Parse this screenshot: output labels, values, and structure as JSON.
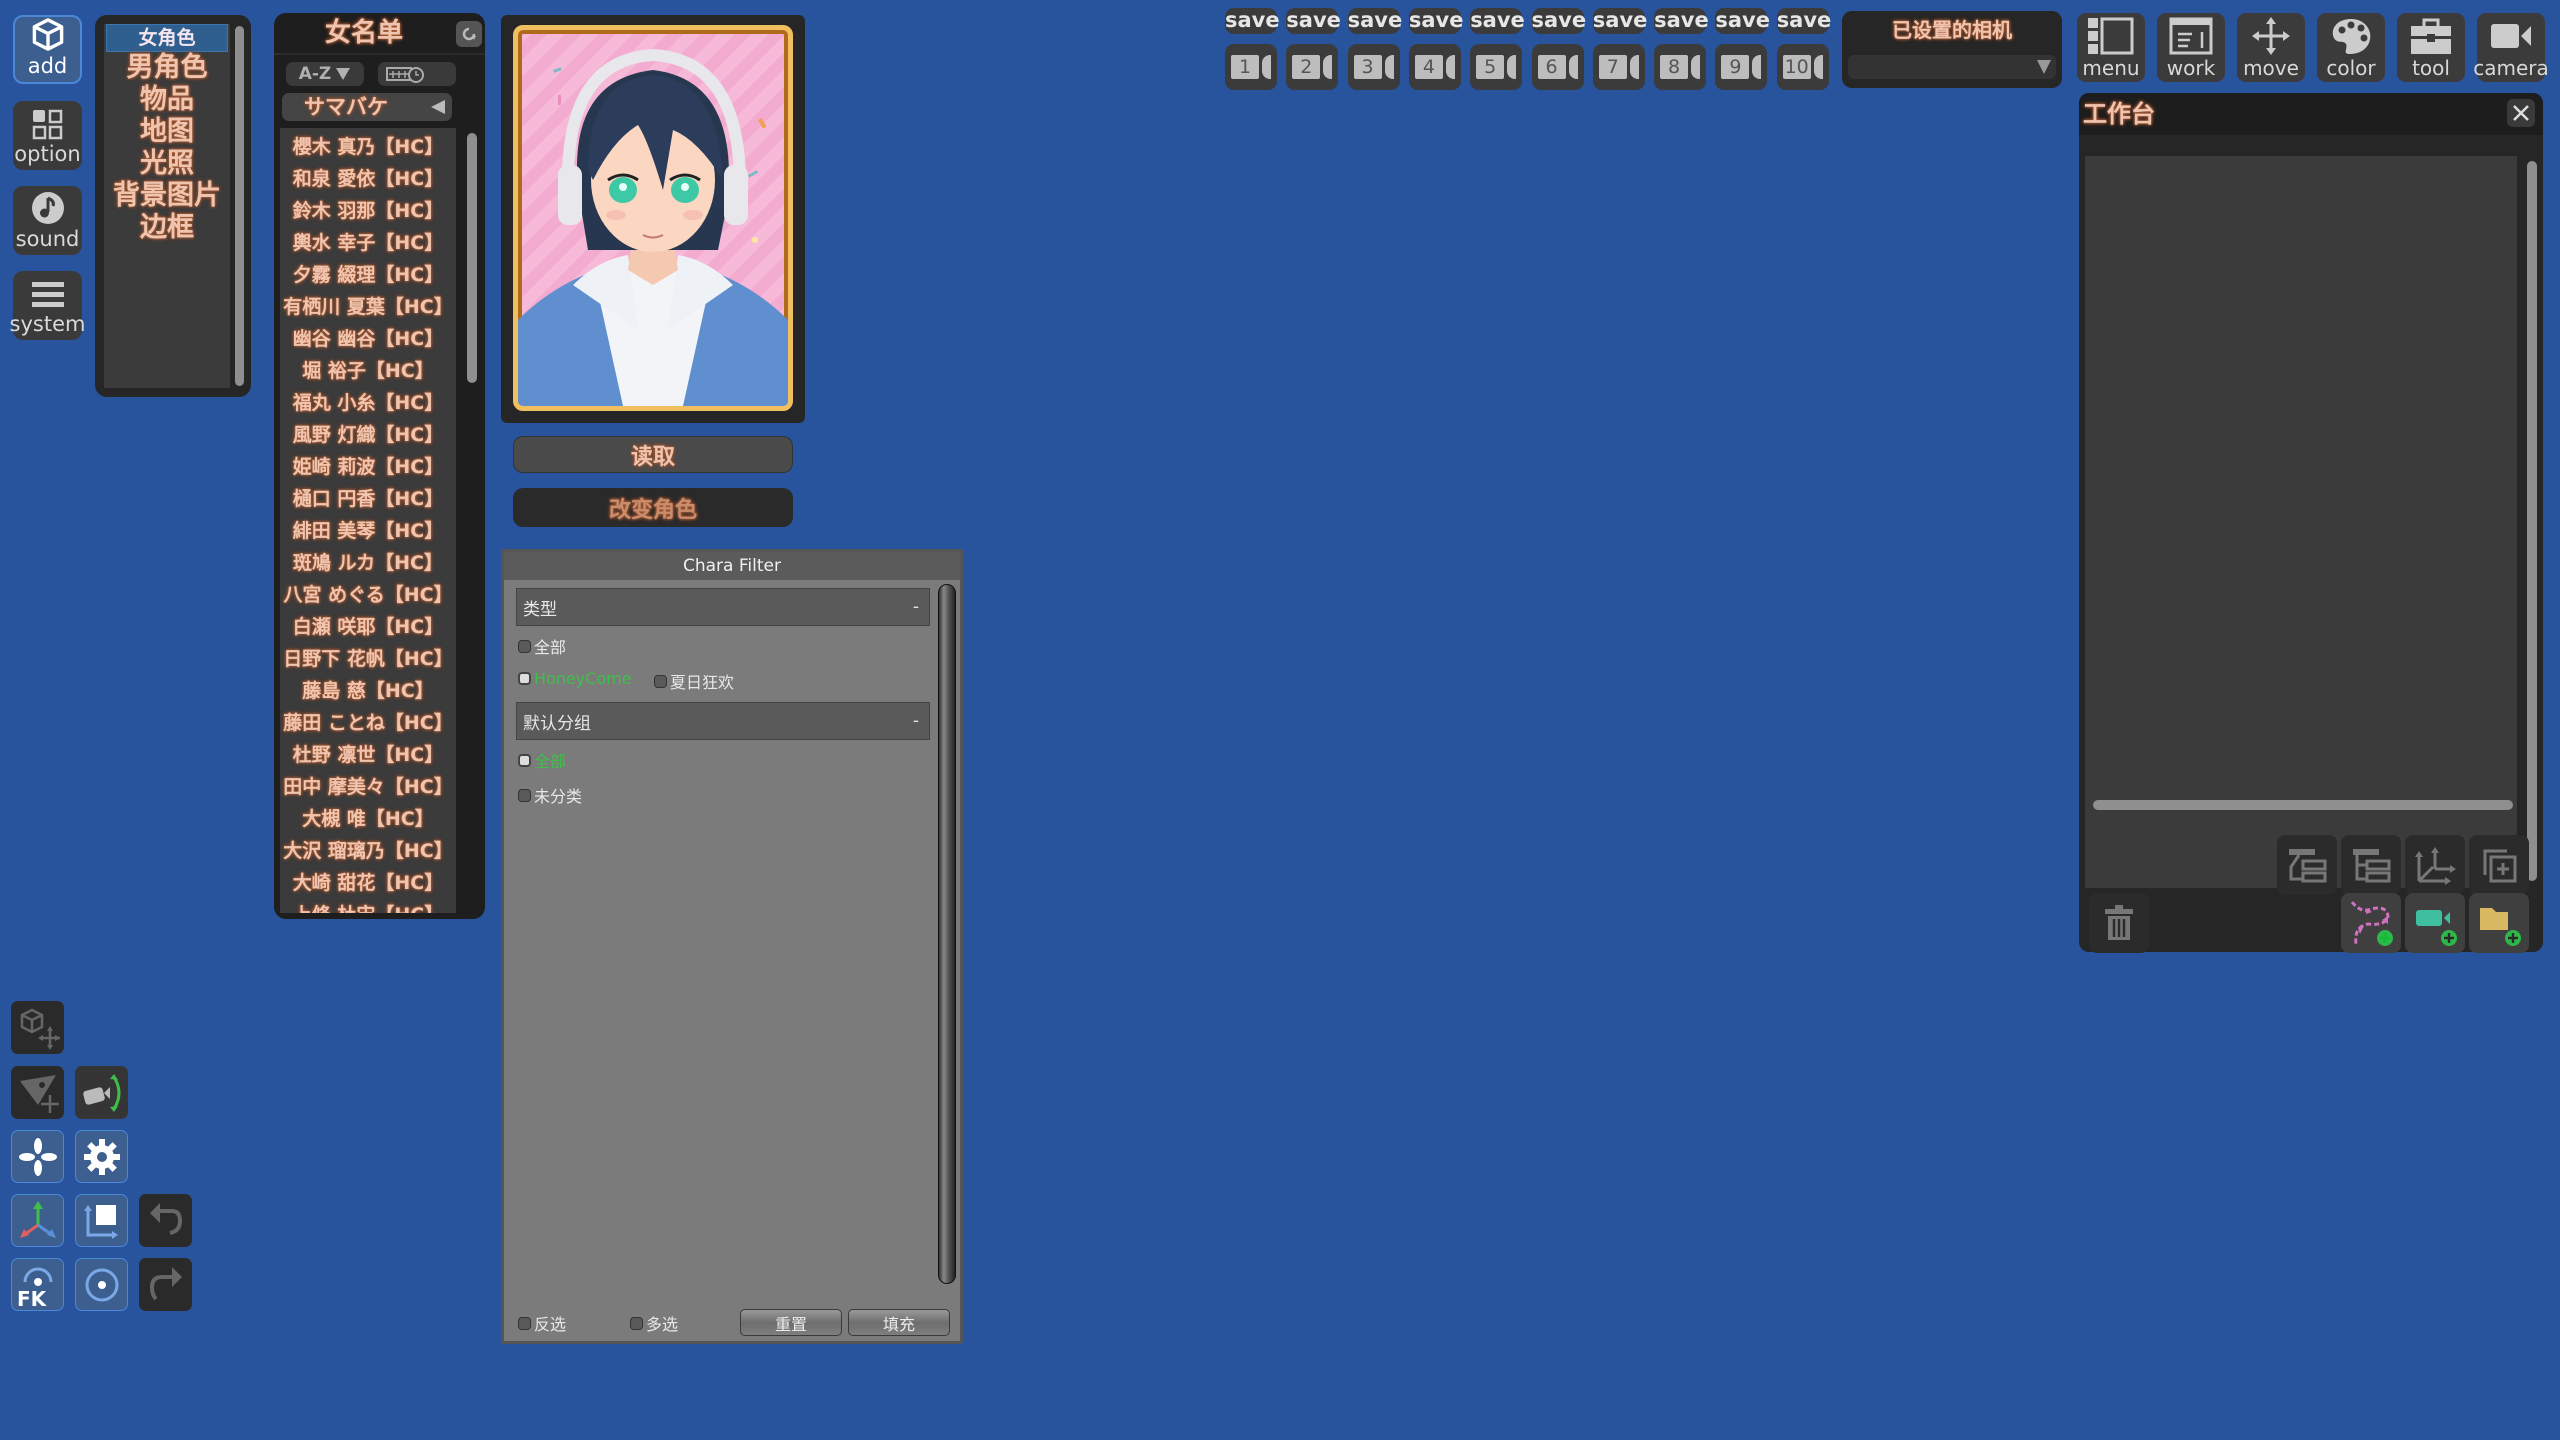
{
  "side_menu": {
    "items": [
      {
        "label": "add",
        "icon": "cube-icon",
        "active": true
      },
      {
        "label": "option",
        "icon": "grid-icon",
        "active": false
      },
      {
        "label": "sound",
        "icon": "music-note-icon",
        "active": false
      },
      {
        "label": "system",
        "icon": "hamburger-icon",
        "active": false
      }
    ]
  },
  "categories": {
    "selected": "女角色",
    "items": [
      "女角色",
      "男角色",
      "物品",
      "地图",
      "光照",
      "背景图片",
      "边框"
    ]
  },
  "names_panel": {
    "title": "女名单",
    "sort_label": "A-Z",
    "group_selected": "サマバケ",
    "names": [
      "櫻木 真乃【HC】",
      "和泉 愛依【HC】",
      "鈴木 羽那【HC】",
      "輿水 幸子【HC】",
      "夕霧 綴理【HC】",
      "有栖川 夏葉【HC】",
      "幽谷 幽谷【HC】",
      "堀 裕子【HC】",
      "福丸 小糸【HC】",
      "風野 灯織【HC】",
      "姫崎 莉波【HC】",
      "樋口 円香【HC】",
      "緋田 美琴【HC】",
      "斑鳩 ルカ【HC】",
      "八宮 めぐる【HC】",
      "白瀬 咲耶【HC】",
      "日野下 花帆【HC】",
      "藤島 慈【HC】",
      "藤田 ことね【HC】",
      "杜野 凛世【HC】",
      "田中 摩美々【HC】",
      "大槻 唯【HC】",
      "大沢 瑠璃乃【HC】",
      "大崎 甜花【HC】",
      "上條 杜宙【HC】"
    ]
  },
  "portrait": {
    "description": "anime girl with short dark blue hair, white headphones, white hoodie and denim jacket on pink striped background"
  },
  "actions": {
    "load_label": "读取",
    "change_label": "改变角色"
  },
  "chara_filter": {
    "title": "Chara Filter",
    "section1": {
      "header": "类型",
      "collapse": "-",
      "options": [
        {
          "label": "全部",
          "checked": false
        },
        {
          "label": "HoneyCome",
          "checked": true
        },
        {
          "label": "夏日狂欢",
          "checked": false
        }
      ]
    },
    "section2": {
      "header": "默认分组",
      "collapse": "-",
      "options": [
        {
          "label": "全部",
          "checked": true
        },
        {
          "label": "未分类",
          "checked": false
        }
      ]
    },
    "invert_label": "反选",
    "multi_label": "多选",
    "reset_label": "重置",
    "fill_label": "填充"
  },
  "save_slots": {
    "save_label": "save",
    "slots": [
      "1",
      "2",
      "3",
      "4",
      "5",
      "6",
      "7",
      "8",
      "9",
      "10"
    ]
  },
  "camera_select": {
    "title": "已设置的相机",
    "value": ""
  },
  "toolbar": {
    "items": [
      {
        "label": "menu",
        "icon": "menu-panel-icon"
      },
      {
        "label": "work",
        "icon": "window-icon"
      },
      {
        "label": "move",
        "icon": "move-arrows-icon"
      },
      {
        "label": "color",
        "icon": "palette-icon"
      },
      {
        "label": "tool",
        "icon": "toolbox-icon"
      },
      {
        "label": "camera",
        "icon": "video-camera-icon"
      }
    ]
  },
  "workbench": {
    "title": "工作台",
    "close": "X"
  },
  "colors": {
    "background": "#27549c",
    "panel_dark": "#262626",
    "accent_glow": "#a55a35",
    "selected_blue": "#2f5f8f",
    "checked_green": "#3fbf4a"
  }
}
